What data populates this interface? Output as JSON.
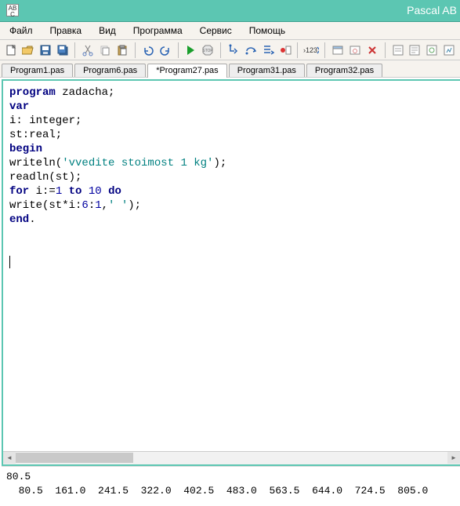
{
  "title": "Pascal AB",
  "menubar": [
    "Файл",
    "Правка",
    "Вид",
    "Программа",
    "Сервис",
    "Помощь"
  ],
  "tabs": [
    {
      "label": "Program1.pas",
      "active": false
    },
    {
      "label": "Program6.pas",
      "active": false
    },
    {
      "label": "*Program27.pas",
      "active": true
    },
    {
      "label": "Program31.pas",
      "active": false
    },
    {
      "label": "Program32.pas",
      "active": false
    }
  ],
  "code": [
    {
      "t": "kw",
      "s": "program"
    },
    {
      "t": "p",
      "s": " zadacha;"
    },
    {
      "t": "nl"
    },
    {
      "t": "kw",
      "s": "var"
    },
    {
      "t": "nl"
    },
    {
      "t": "p",
      "s": "i: integer;"
    },
    {
      "t": "nl"
    },
    {
      "t": "p",
      "s": "st:real;"
    },
    {
      "t": "nl"
    },
    {
      "t": "kw",
      "s": "begin"
    },
    {
      "t": "nl"
    },
    {
      "t": "p",
      "s": "writeln("
    },
    {
      "t": "str",
      "s": "'vvedite stoimost 1 kg'"
    },
    {
      "t": "p",
      "s": ");"
    },
    {
      "t": "nl"
    },
    {
      "t": "p",
      "s": "readln(st);"
    },
    {
      "t": "nl"
    },
    {
      "t": "kw",
      "s": "for"
    },
    {
      "t": "p",
      "s": " i:="
    },
    {
      "t": "num",
      "s": "1"
    },
    {
      "t": "p",
      "s": " "
    },
    {
      "t": "kw",
      "s": "to"
    },
    {
      "t": "p",
      "s": " "
    },
    {
      "t": "num",
      "s": "10"
    },
    {
      "t": "p",
      "s": " "
    },
    {
      "t": "kw",
      "s": "do"
    },
    {
      "t": "nl"
    },
    {
      "t": "p",
      "s": "write(st*i:"
    },
    {
      "t": "num",
      "s": "6"
    },
    {
      "t": "p",
      "s": ":"
    },
    {
      "t": "num",
      "s": "1"
    },
    {
      "t": "p",
      "s": ","
    },
    {
      "t": "str",
      "s": "' '"
    },
    {
      "t": "p",
      "s": ");"
    },
    {
      "t": "nl"
    },
    {
      "t": "kw",
      "s": "end"
    },
    {
      "t": "p",
      "s": "."
    },
    {
      "t": "nl"
    },
    {
      "t": "nl"
    },
    {
      "t": "nl"
    },
    {
      "t": "caret"
    }
  ],
  "output": {
    "line1": "80.5",
    "line2": "  80.5  161.0  241.5  322.0  402.5  483.0  563.5  644.0  724.5  805.0"
  }
}
